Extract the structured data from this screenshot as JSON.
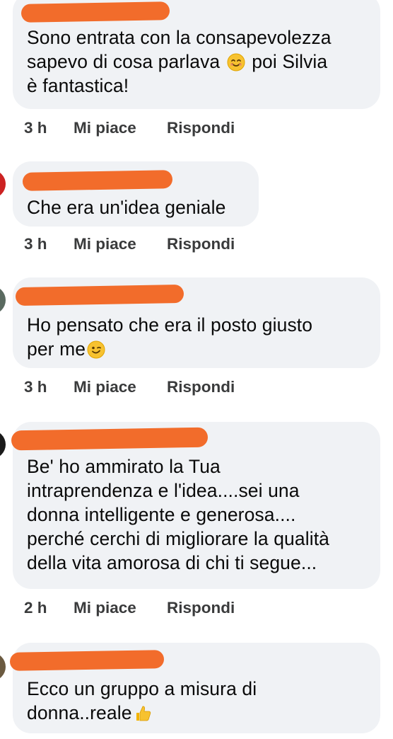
{
  "comments": [
    {
      "text_lines": [
        "Sono entrata con la consapevolezza",
        "sapevo di cosa parlava",
        "è fantastica!"
      ],
      "line2_tail": "poi Silvia",
      "emoji": "smiling-face-icon",
      "time": "3 h",
      "like": "Mi piace",
      "reply": "Rispondi"
    },
    {
      "text_lines": [
        "Che era un'idea geniale"
      ],
      "time": "3 h",
      "like": "Mi piace",
      "reply": "Rispondi"
    },
    {
      "text_lines": [
        "Ho pensato che era il posto giusto",
        "per me"
      ],
      "emoji": "winking-face-icon",
      "time": "3 h",
      "like": "Mi piace",
      "reply": "Rispondi"
    },
    {
      "text_lines": [
        "Be' ho ammirato la Tua",
        "intraprendenza e l'idea....sei una",
        "donna intelligente e generosa....",
        "perché cerchi di migliorare la qualità",
        "della vita amorosa di chi ti segue..."
      ],
      "time": "2 h",
      "like": "Mi piace",
      "reply": "Rispondi"
    },
    {
      "text_lines": [
        "Ecco un gruppo a misura di",
        "donna..reale"
      ],
      "emoji": "thumbs-up-icon",
      "time": "",
      "like": "",
      "reply": ""
    }
  ],
  "colors": {
    "bubble": "#f0f2f5",
    "redaction": "#f26c2b",
    "meta_text": "#3a3b3c"
  }
}
